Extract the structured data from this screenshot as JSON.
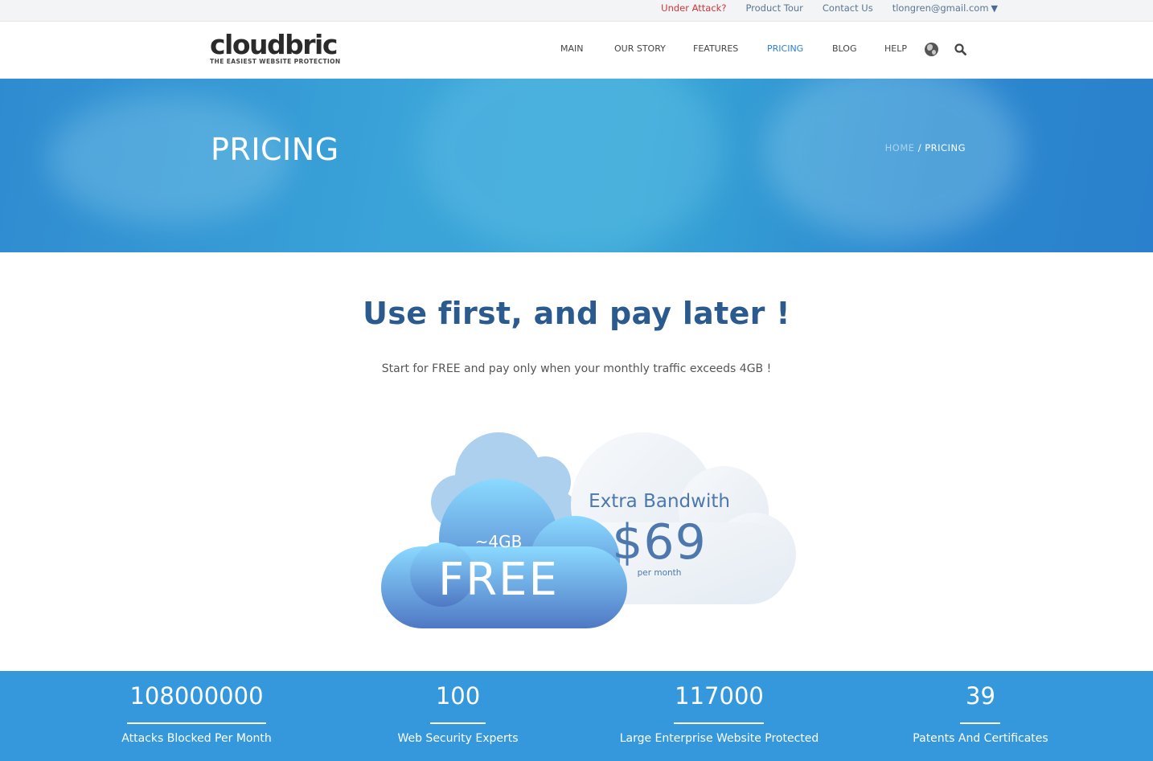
{
  "topbar": {
    "under_attack": "Under Attack?",
    "product_tour": "Product Tour",
    "contact_us": "Contact Us",
    "account_email": "tlongren@gmail.com"
  },
  "header": {
    "logo_word": "cloudbric",
    "logo_tagline": "THE EASIEST WEBSITE PROTECTION",
    "nav": {
      "main": "MAIN",
      "our_story": "OUR STORY",
      "features": "FEATURES",
      "pricing": "PRICING",
      "blog": "BLOG",
      "help": "HELP"
    },
    "active_nav": "PRICING"
  },
  "hero": {
    "title": "PRICING",
    "breadcrumb_home": "HOME",
    "breadcrumb_sep": " / ",
    "breadcrumb_current": "PRICING"
  },
  "main": {
    "headline": "Use first, and pay later !",
    "subline": "Start for FREE and pay only when your monthly traffic exceeds 4GB !",
    "free_plan": {
      "size": "~4GB",
      "label": "FREE"
    },
    "extra_plan": {
      "title": "Extra Bandwith",
      "price": "$69",
      "period": "per month"
    }
  },
  "stats": [
    {
      "value": "108000000",
      "label": "Attacks Blocked Per Month"
    },
    {
      "value": "100",
      "label": "Web Security Experts"
    },
    {
      "value": "117000",
      "label": "Large Enterprise Website Protected"
    },
    {
      "value": "39",
      "label": "Patents And Certificates"
    }
  ],
  "colors": {
    "accent": "#2a7fd0",
    "alert": "#d2363a",
    "stats_bg": "#3598dc",
    "headline": "#2a5a8e"
  }
}
